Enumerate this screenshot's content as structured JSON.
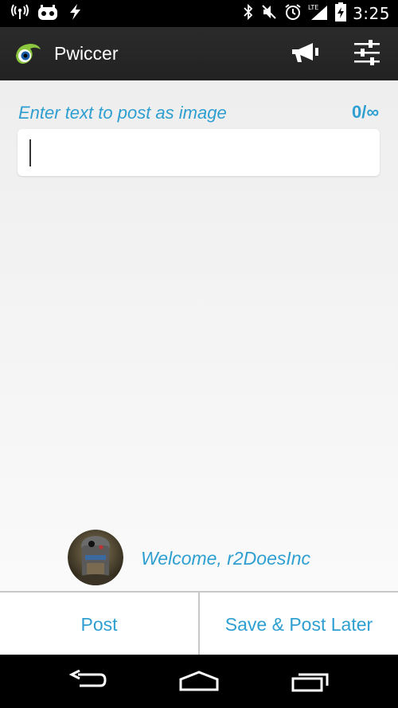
{
  "status_bar": {
    "time": "3:25",
    "left_icons": [
      "wifi-hotspot-icon",
      "cyanogen-icon",
      "flash-icon"
    ],
    "right_icons": [
      "bluetooth-icon",
      "mute-icon",
      "alarm-icon",
      "lte-signal-icon",
      "battery-charging-icon"
    ]
  },
  "action_bar": {
    "title": "Pwiccer",
    "actions": [
      "megaphone-icon",
      "settings-sliders-icon"
    ]
  },
  "compose": {
    "prompt": "Enter text to post as image",
    "counter": "0/∞",
    "input_value": ""
  },
  "user": {
    "welcome": "Welcome, r2DoesInc"
  },
  "buttons": {
    "post": "Post",
    "save_later": "Save & Post Later"
  },
  "colors": {
    "accent": "#2e9fd0",
    "action_bar": "#262626"
  }
}
